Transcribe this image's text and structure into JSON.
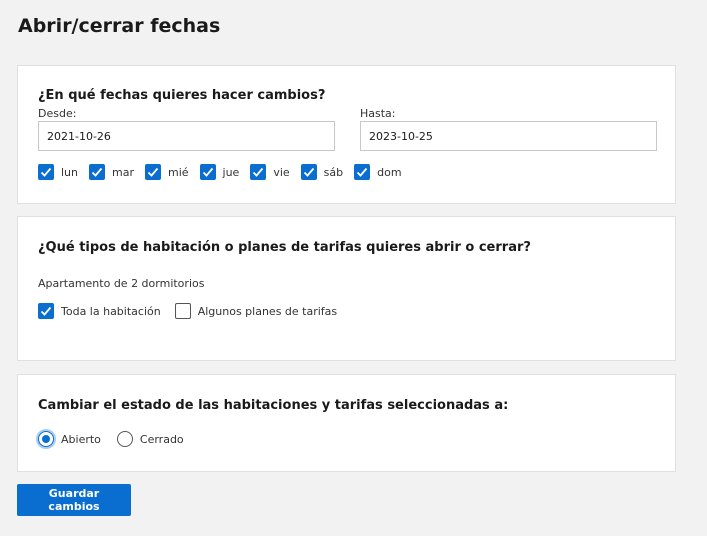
{
  "page": {
    "title": "Abrir/cerrar fechas"
  },
  "dates_section": {
    "title": "¿En qué fechas quieres hacer cambios?",
    "from_label": "Desde:",
    "from_value": "2021-10-26",
    "to_label": "Hasta:",
    "to_value": "2023-10-25",
    "days": [
      {
        "label": "lun",
        "checked": true
      },
      {
        "label": "mar",
        "checked": true
      },
      {
        "label": "mié",
        "checked": true
      },
      {
        "label": "jue",
        "checked": true
      },
      {
        "label": "vie",
        "checked": true
      },
      {
        "label": "sáb",
        "checked": true
      },
      {
        "label": "dom",
        "checked": true
      }
    ]
  },
  "rooms_section": {
    "title": "¿Qué tipos de habitación o planes de tarifas quieres abrir o cerrar?",
    "room_name": "Apartamento de 2 dormitorios",
    "options": [
      {
        "label": "Toda la habitación",
        "checked": true
      },
      {
        "label": "Algunos planes de tarifas",
        "checked": false
      }
    ]
  },
  "status_section": {
    "title": "Cambiar el estado de las habitaciones y tarifas seleccionadas a:",
    "options": [
      {
        "label": "Abierto",
        "selected": true
      },
      {
        "label": "Cerrado",
        "selected": false
      }
    ]
  },
  "actions": {
    "save_label": "Guardar cambios"
  },
  "colors": {
    "accent": "#0a6ed1",
    "background": "#f2f2f2",
    "card": "#ffffff"
  }
}
